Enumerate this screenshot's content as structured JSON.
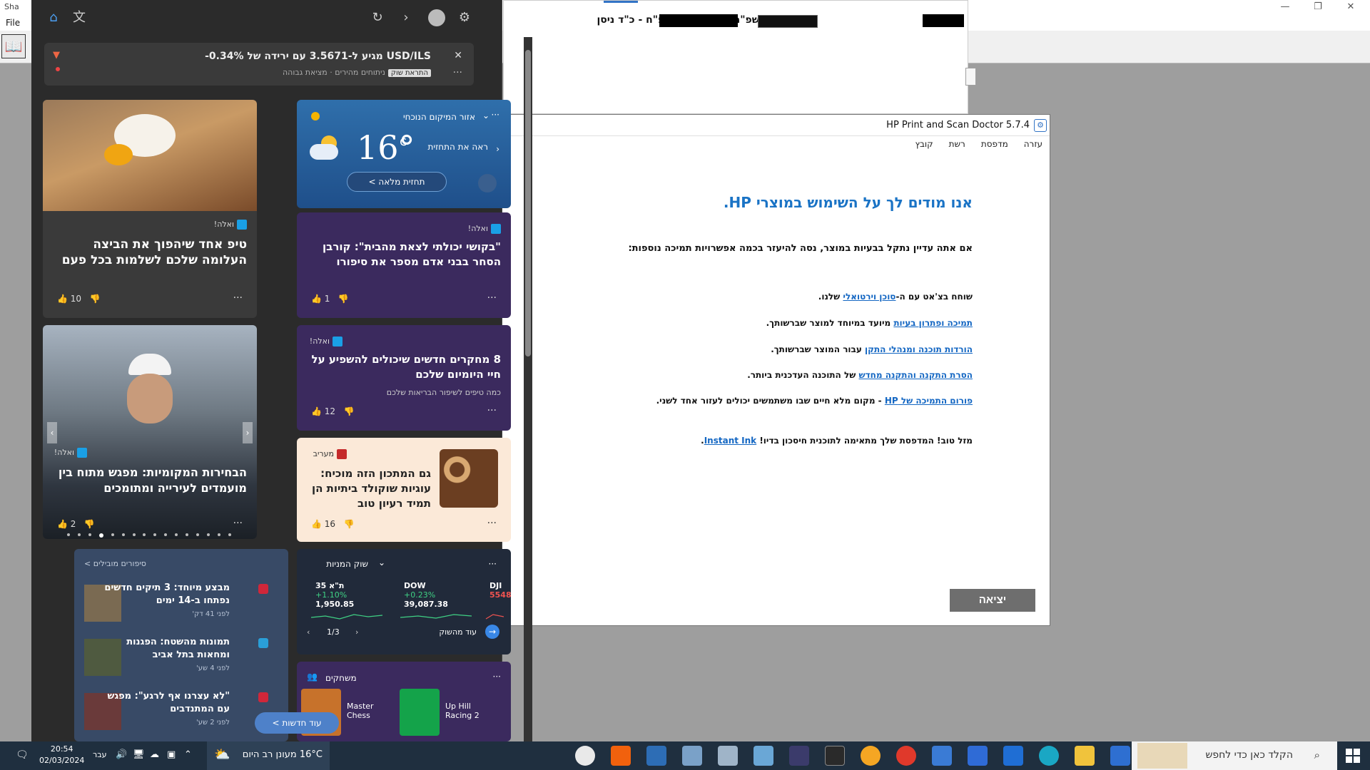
{
  "bgapp": {
    "title": "Sha",
    "menu_file": "File",
    "doc_text": "חשפ\"חןיבן  ב כסלו חשפ\"ח - כ\"ד ניסן"
  },
  "hp": {
    "title": "HP Print and Scan Doctor 5.7.4",
    "menu": [
      "קובץ",
      "רשת",
      "מדפסת",
      "עזרה"
    ],
    "heading": "אנו מודים לך על השימוש במוצרי HP.",
    "subhead": "אם אתה עדיין נתקל בבעיות במוצר, נסה להיעזר בכמה אפשרויות תמיכה נוספות:",
    "lines": [
      {
        "prefix": "שוחח בצ'אט עם ה-",
        "link": "סוכן וירטואלי",
        "suffix": " שלנו."
      },
      {
        "prefix": "",
        "link": "תמיכה ופתרון בעיות",
        "suffix": " מיועד במיוחד למוצר שברשותך."
      },
      {
        "prefix": "",
        "link": "הורדות תוכנה ומנהלי התקן",
        "suffix": " עבור המוצר שברשותך."
      },
      {
        "prefix": "",
        "link": "הסרת התקנה והתקנה מחדש",
        "suffix": " של התוכנה העדכנית ביותר."
      },
      {
        "prefix": "",
        "link": "פורום התמיכה של HP",
        "suffix": " - מקום מלא חיים שבו משתמשים יכולים לעזור אחד לשני."
      },
      {
        "prefix": "מזל טוב! המדפסת שלך מתאימה לתוכנית חיסכון בדיו! ",
        "link": "Instant Ink",
        "suffix": "."
      }
    ],
    "exit_label": "יציאה"
  },
  "widget": {
    "alert": {
      "title": "USD/ILS מגיע ל-3.5671 עם ירידה של ‎-0.34%",
      "badge": "התראת שוק",
      "sub": "ניתוחים מהירים · מציאת גבוהה"
    },
    "cards": [
      {
        "source": "ואלה!",
        "headline": "טיפ אחד שיהפוך את הביצה העלומה שלכם לשלמות בכל פעם",
        "likes": "10"
      },
      {
        "source": "ואלה!",
        "headline": "\"בקושי יכולתי לצאת מהבית\": קורבן הסחר בבני אדם מספר את סיפורו",
        "likes": "1"
      },
      {
        "source": "ואלה!",
        "headline": "8 מחקרים חדשים שיכולים להשפיע על חיי היומיום שלכם",
        "likes": "12",
        "sub": "כמה טיפים לשיפור הבריאות שלכם"
      },
      {
        "source": "ואלה!",
        "headline": "הבחירות המקומיות: מפגש מתוח בין מועמדים לעירייה ומתומכים",
        "likes": "2"
      },
      {
        "source": "מעריב",
        "headline": "גם המתכון הזה מוכיח: עוגיות שוקולד ביתיות הן תמיד רעיון טוב",
        "likes": "16"
      }
    ],
    "weather": {
      "location": "אזור המיקום הנוכחי",
      "temp": "16°",
      "unit": "c",
      "desc": "ראה את התחזית",
      "btn": "תחזית מלאה >"
    },
    "stocks": {
      "header": "שוק המניות",
      "items": [
        {
          "name": "DJI",
          "chg": "",
          "val": "5548"
        },
        {
          "name": "DOW",
          "chg": "+0.23%",
          "val": "39,087.38"
        },
        {
          "name": "ת\"א 35",
          "chg": "+1.10%",
          "val": "1,950.85"
        }
      ],
      "pager": "1/3",
      "footer": "עוד מהשוק"
    },
    "games": {
      "header": "משחקים",
      "g1": "Master Chess",
      "g2": "Up Hill Racing 2"
    },
    "trends": {
      "header": "סיפורים מובילים >",
      "items": [
        {
          "title": "מבצע מיוחד: 3 תיקים חדשים נפתחו ב-14 ימים",
          "meta": "לפני 41 דק'"
        },
        {
          "title": "תמונות מהשטח: הפגנות ומחאות בתל אביב",
          "meta": "לפני 4 שע'"
        },
        {
          "title": "\"לא עצרנו אף לרגע\": מפגש עם המתנדבים",
          "meta": "לפני 2 שע'"
        }
      ],
      "more_btn": "עוד חדשות >"
    }
  },
  "taskbar": {
    "time": "20:54",
    "date": "02/03/2024",
    "lang": "עבר",
    "weather": "16°C  מעונן רב היום",
    "search": "הקלד כאן כדי לחפש"
  }
}
